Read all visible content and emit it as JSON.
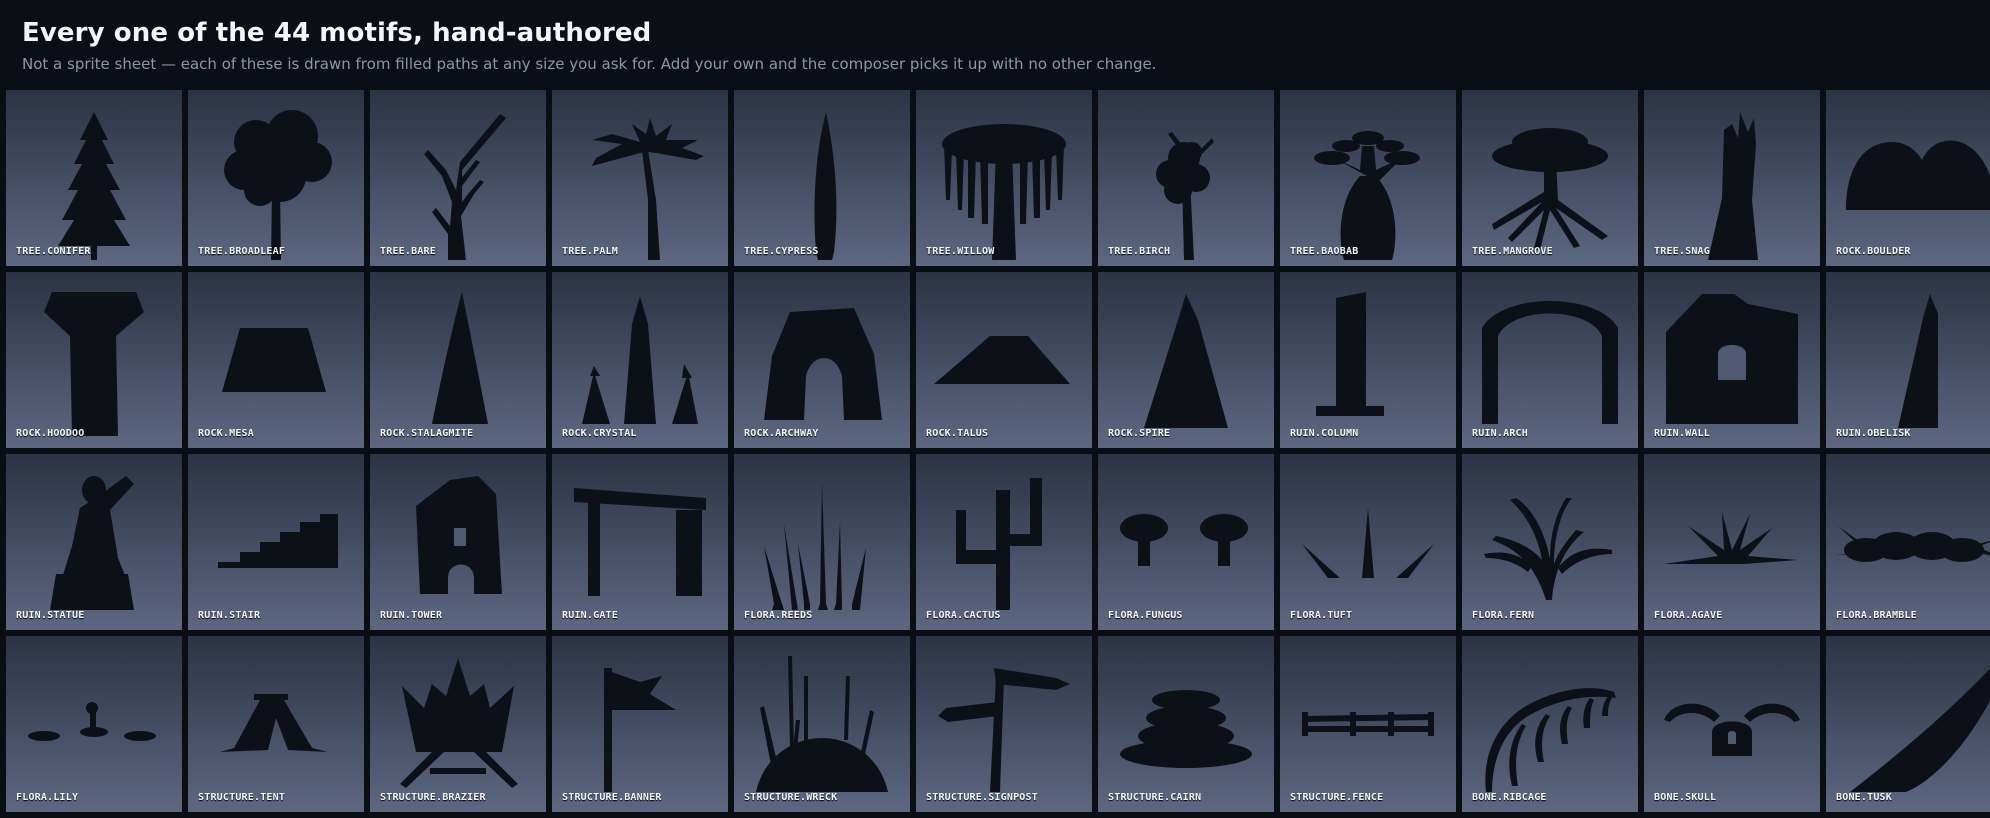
{
  "header": {
    "title": "Every one of the 44 motifs, hand-authored",
    "subtitle": "Not a sprite sheet — each of these is drawn from filled paths at any size you ask for. Add your own and the composer picks it up with no other change."
  },
  "colors": {
    "silhouette": "#0d1117",
    "page_background": "#0a0d12"
  },
  "motifs": [
    {
      "label": "TREE.CONIFER",
      "icon": "conifer-icon"
    },
    {
      "label": "TREE.BROADLEAF",
      "icon": "broadleaf-icon"
    },
    {
      "label": "TREE.BARE",
      "icon": "bare-tree-icon"
    },
    {
      "label": "TREE.PALM",
      "icon": "palm-icon"
    },
    {
      "label": "TREE.CYPRESS",
      "icon": "cypress-icon"
    },
    {
      "label": "TREE.WILLOW",
      "icon": "willow-icon"
    },
    {
      "label": "TREE.BIRCH",
      "icon": "birch-icon"
    },
    {
      "label": "TREE.BAOBAB",
      "icon": "baobab-icon"
    },
    {
      "label": "TREE.MANGROVE",
      "icon": "mangrove-icon"
    },
    {
      "label": "TREE.SNAG",
      "icon": "snag-icon"
    },
    {
      "label": "ROCK.BOULDER",
      "icon": "boulder-icon"
    },
    {
      "label": "ROCK.HOODOO",
      "icon": "hoodoo-icon"
    },
    {
      "label": "ROCK.MESA",
      "icon": "mesa-icon"
    },
    {
      "label": "ROCK.STALAGMITE",
      "icon": "stalagmite-icon"
    },
    {
      "label": "ROCK.CRYSTAL",
      "icon": "crystal-icon"
    },
    {
      "label": "ROCK.ARCHWAY",
      "icon": "archway-icon"
    },
    {
      "label": "ROCK.TALUS",
      "icon": "talus-icon"
    },
    {
      "label": "ROCK.SPIRE",
      "icon": "spire-icon"
    },
    {
      "label": "RUIN.COLUMN",
      "icon": "column-icon"
    },
    {
      "label": "RUIN.ARCH",
      "icon": "ruin-arch-icon"
    },
    {
      "label": "RUIN.WALL",
      "icon": "ruin-wall-icon"
    },
    {
      "label": "RUIN.OBELISK",
      "icon": "obelisk-icon"
    },
    {
      "label": "RUIN.STATUE",
      "icon": "statue-icon"
    },
    {
      "label": "RUIN.STAIR",
      "icon": "stair-icon"
    },
    {
      "label": "RUIN.TOWER",
      "icon": "tower-icon"
    },
    {
      "label": "RUIN.GATE",
      "icon": "gate-icon"
    },
    {
      "label": "FLORA.REEDS",
      "icon": "reeds-icon"
    },
    {
      "label": "FLORA.CACTUS",
      "icon": "cactus-icon"
    },
    {
      "label": "FLORA.FUNGUS",
      "icon": "fungus-icon"
    },
    {
      "label": "FLORA.TUFT",
      "icon": "tuft-icon"
    },
    {
      "label": "FLORA.FERN",
      "icon": "fern-icon"
    },
    {
      "label": "FLORA.AGAVE",
      "icon": "agave-icon"
    },
    {
      "label": "FLORA.BRAMBLE",
      "icon": "bramble-icon"
    },
    {
      "label": "FLORA.LILY",
      "icon": "lily-icon"
    },
    {
      "label": "STRUCTURE.TENT",
      "icon": "tent-icon"
    },
    {
      "label": "STRUCTURE.BRAZIER",
      "icon": "brazier-icon"
    },
    {
      "label": "STRUCTURE.BANNER",
      "icon": "banner-icon"
    },
    {
      "label": "STRUCTURE.WRECK",
      "icon": "wreck-icon"
    },
    {
      "label": "STRUCTURE.SIGNPOST",
      "icon": "signpost-icon"
    },
    {
      "label": "STRUCTURE.CAIRN",
      "icon": "cairn-icon"
    },
    {
      "label": "STRUCTURE.FENCE",
      "icon": "fence-icon"
    },
    {
      "label": "BONE.RIBCAGE",
      "icon": "ribcage-icon"
    },
    {
      "label": "BONE.SKULL",
      "icon": "skull-icon"
    },
    {
      "label": "BONE.TUSK",
      "icon": "tusk-icon"
    }
  ]
}
